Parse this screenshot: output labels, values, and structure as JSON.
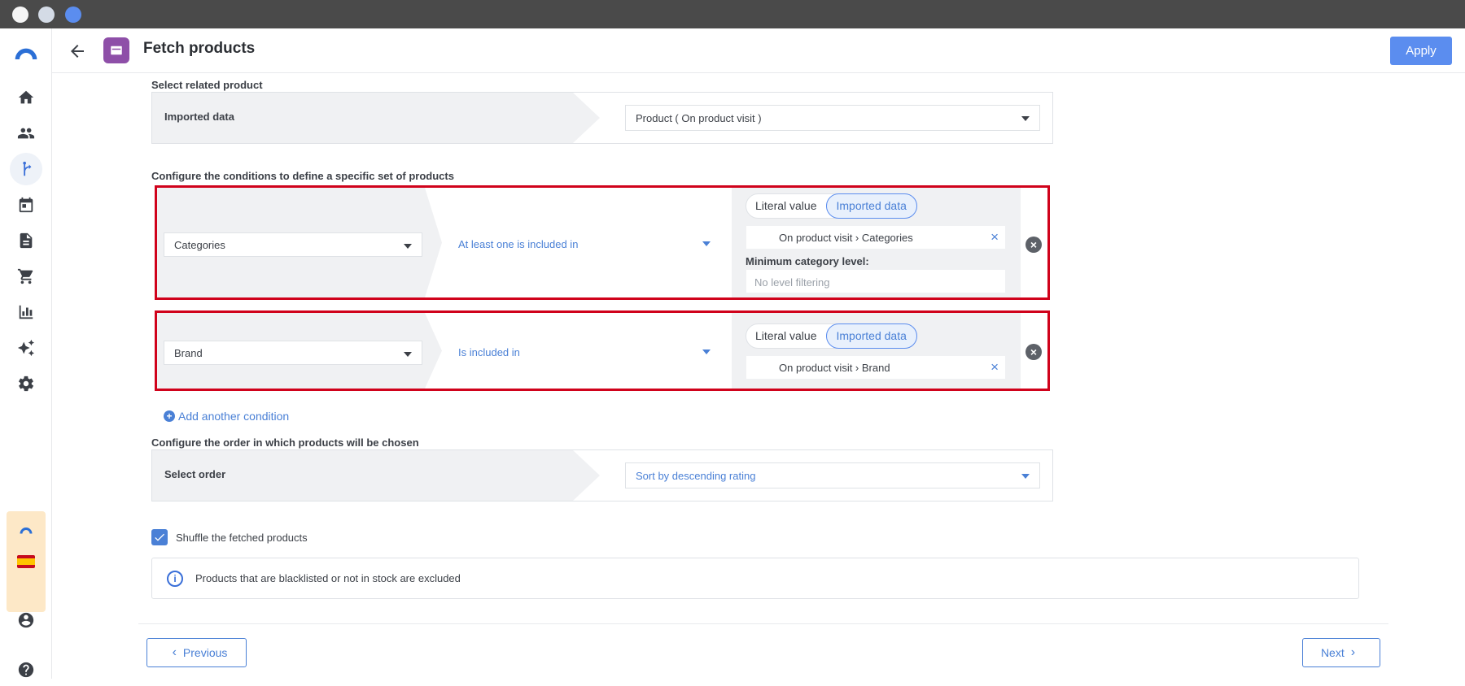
{
  "header": {
    "title": "Fetch products",
    "apply_label": "Apply"
  },
  "sidebar": {
    "items": [
      "home-icon",
      "users-icon",
      "flow-icon",
      "calendar-icon",
      "document-icon",
      "cart-icon",
      "chart-icon",
      "sparkle-icon",
      "gear-icon",
      "account-icon",
      "help-icon"
    ],
    "active": "flow-icon"
  },
  "related": {
    "section_label": "Select related product",
    "left_label": "Imported data",
    "value": "Product ( On product visit )"
  },
  "conditions": {
    "section_label": "Configure the conditions to define a specific set of products",
    "items": [
      {
        "field": "Categories",
        "operator": "At least one is included in",
        "toggle_literal": "Literal value",
        "toggle_imported": "Imported data",
        "chip": "On product visit › Categories",
        "min_label": "Minimum category level:",
        "min_placeholder": "No level filtering"
      },
      {
        "field": "Brand",
        "operator": "Is included in",
        "toggle_literal": "Literal value",
        "toggle_imported": "Imported data",
        "chip": "On product visit › Brand"
      }
    ],
    "add_label": "Add another condition"
  },
  "order": {
    "section_label": "Configure the order in which products will be chosen",
    "left_label": "Select order",
    "value": "Sort by descending rating"
  },
  "shuffle": {
    "label": "Shuffle the fetched products",
    "checked": true
  },
  "info": {
    "text": "Products that are blacklisted or not in stock are excluded"
  },
  "footer": {
    "previous_label": "Previous",
    "next_label": "Next"
  },
  "colors": {
    "accent": "#5b8def",
    "highlight_border": "#d0021b",
    "header_badge": "#8e4fa8"
  }
}
